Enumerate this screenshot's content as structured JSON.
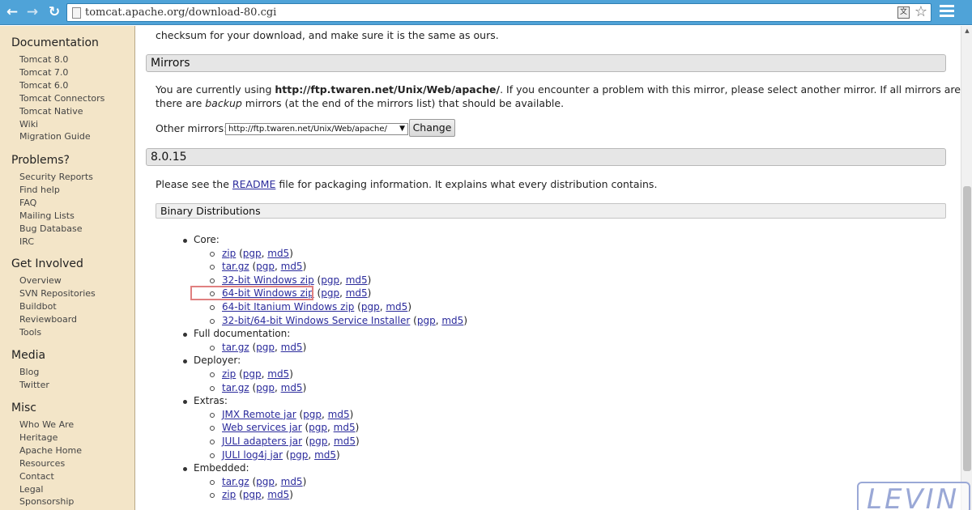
{
  "browser": {
    "url": "tomcat.apache.org/download-80.cgi",
    "back": "←",
    "forward": "→",
    "reload": "↻",
    "star": "☆",
    "translate": "文"
  },
  "sidebar": {
    "sections": [
      {
        "title": "Documentation",
        "items": [
          "Tomcat 8.0",
          "Tomcat 7.0",
          "Tomcat 6.0",
          "Tomcat Connectors",
          "Tomcat Native",
          "Wiki",
          "Migration Guide"
        ]
      },
      {
        "title": "Problems?",
        "items": [
          "Security Reports",
          "Find help",
          "FAQ",
          "Mailing Lists",
          "Bug Database",
          "IRC"
        ]
      },
      {
        "title": "Get Involved",
        "items": [
          "Overview",
          "SVN Repositories",
          "Buildbot",
          "Reviewboard",
          "Tools"
        ]
      },
      {
        "title": "Media",
        "items": [
          "Blog",
          "Twitter"
        ]
      },
      {
        "title": "Misc",
        "items": [
          "Who We Are",
          "Heritage",
          "Apache Home",
          "Resources",
          "Contact",
          "Legal",
          "Sponsorship"
        ]
      }
    ]
  },
  "main": {
    "top_text": "checksum for your download, and make sure it is the same as ours.",
    "mirrors": {
      "title": "Mirrors",
      "line1_pre": "You are currently using ",
      "line1_url": "http://ftp.twaren.net/Unix/Web/apache/",
      "line1_post": ". If you encounter a problem with this mirror, please select another mirror. If all mirrors are failing,",
      "line2_pre": "there are ",
      "line2_em": "backup",
      "line2_post": " mirrors (at the end of the mirrors list) that should be available.",
      "other_label": "Other mirrors:",
      "select_value": "http://ftp.twaren.net/Unix/Web/apache/",
      "change_label": "Change"
    },
    "version": {
      "title": "8.0.15",
      "readme_pre": "Please see the ",
      "readme_link": "README",
      "readme_post": " file for packaging information. It explains what every distribution contains.",
      "binary_title": "Binary Distributions"
    },
    "groups": [
      {
        "label": "Core:",
        "items": [
          {
            "name": "zip",
            "sigs": [
              "pgp",
              "md5"
            ]
          },
          {
            "name": "tar.gz",
            "sigs": [
              "pgp",
              "md5"
            ]
          },
          {
            "name": "32-bit Windows zip",
            "sigs": [
              "pgp",
              "md5"
            ]
          },
          {
            "name": "64-bit Windows zip",
            "sigs": [
              "pgp",
              "md5"
            ],
            "highlighted": true
          },
          {
            "name": "64-bit Itanium Windows zip",
            "sigs": [
              "pgp",
              "md5"
            ]
          },
          {
            "name": "32-bit/64-bit Windows Service Installer",
            "sigs": [
              "pgp",
              "md5"
            ]
          }
        ]
      },
      {
        "label": "Full documentation:",
        "items": [
          {
            "name": "tar.gz",
            "sigs": [
              "pgp",
              "md5"
            ]
          }
        ]
      },
      {
        "label": "Deployer:",
        "items": [
          {
            "name": "zip",
            "sigs": [
              "pgp",
              "md5"
            ]
          },
          {
            "name": "tar.gz",
            "sigs": [
              "pgp",
              "md5"
            ]
          }
        ]
      },
      {
        "label": "Extras:",
        "items": [
          {
            "name": "JMX Remote jar",
            "sigs": [
              "pgp",
              "md5"
            ]
          },
          {
            "name": "Web services jar",
            "sigs": [
              "pgp",
              "md5"
            ]
          },
          {
            "name": "JULI adapters jar",
            "sigs": [
              "pgp",
              "md5"
            ]
          },
          {
            "name": "JULI log4j jar",
            "sigs": [
              "pgp",
              "md5"
            ]
          }
        ]
      },
      {
        "label": "Embedded:",
        "items": [
          {
            "name": "tar.gz",
            "sigs": [
              "pgp",
              "md5"
            ]
          },
          {
            "name": "zip",
            "sigs": [
              "pgp",
              "md5"
            ]
          }
        ]
      }
    ]
  },
  "watermark": "LEVIN",
  "colors": {
    "link": "#2b2b9c",
    "sidebar_bg": "#f3e5c8",
    "chrome": "#4fa3d8",
    "highlight": "#e08080"
  }
}
